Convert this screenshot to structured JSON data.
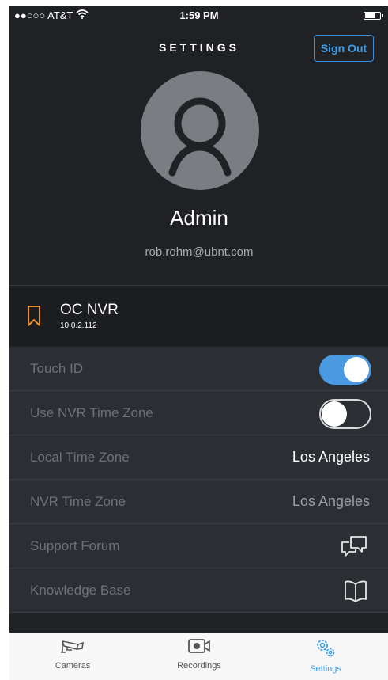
{
  "status_bar": {
    "carrier": "●●○○○ AT&T",
    "time": "1:59 PM"
  },
  "header": {
    "title": "SETTINGS",
    "sign_out_label": "Sign Out"
  },
  "profile": {
    "name": "Admin",
    "email": "rob.rohm@ubnt.com"
  },
  "nvr": {
    "name": "OC NVR",
    "ip": "10.0.2.112"
  },
  "settings": {
    "touch_id": {
      "label": "Touch ID",
      "enabled": true
    },
    "use_nvr_time_zone": {
      "label": "Use NVR Time Zone",
      "enabled": false
    },
    "local_time_zone": {
      "label": "Local Time Zone",
      "value": "Los Angeles"
    },
    "nvr_time_zone": {
      "label": "NVR Time Zone",
      "value": "Los Angeles"
    },
    "support_forum": {
      "label": "Support Forum",
      "icon": "chat-bubbles-icon"
    },
    "knowledge_base": {
      "label": "Knowledge Base",
      "icon": "open-book-icon"
    }
  },
  "tabs": [
    {
      "label": "Cameras",
      "icon": "camera-icon",
      "active": false
    },
    {
      "label": "Recordings",
      "icon": "recordings-icon",
      "active": false
    },
    {
      "label": "Settings",
      "icon": "gears-icon",
      "active": true
    }
  ],
  "colors": {
    "accent": "#3a9ee8",
    "nvr_bookmark": "#e8932f",
    "background": "#1f2124"
  }
}
